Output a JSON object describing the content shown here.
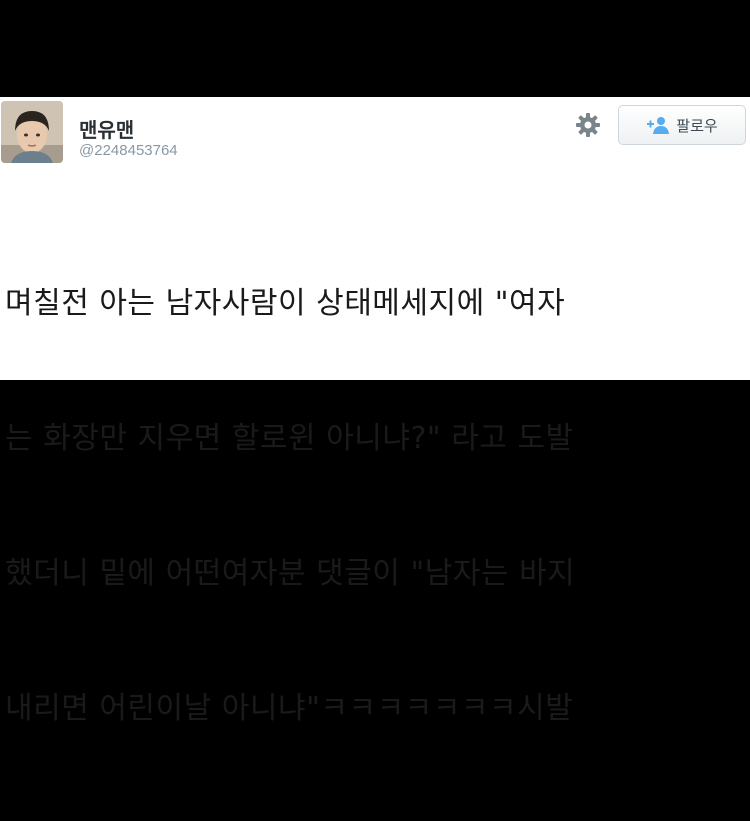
{
  "user": {
    "display_name": "맨유맨",
    "handle": "@2248453764"
  },
  "actions": {
    "follow_label": "팔로우",
    "settings_icon": "gear-icon",
    "follow_icon": "add-user-icon"
  },
  "tweet": {
    "lines": [
      "며칠전 아는 남자사람이 상태메세지에 \"여자",
      "는 화장만 지우면 할로윈 아니냐?\" 라고 도발",
      "했더니 밑에 어떤여자분 댓글이 \"남자는 바지",
      "내리면 어린이날 아니냐\"ㅋㅋㅋㅋㅋㅋㅋ시발"
    ]
  },
  "colors": {
    "background": "#000000",
    "card": "#ffffff",
    "handle": "#8899a6",
    "follow_accent": "#55acee"
  }
}
